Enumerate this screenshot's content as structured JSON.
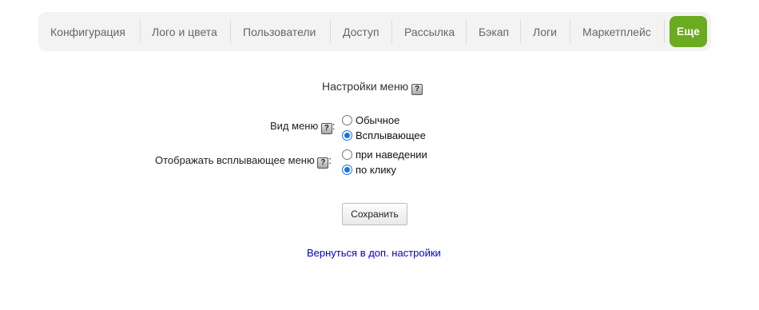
{
  "nav": {
    "items": [
      {
        "label": "Конфигурация"
      },
      {
        "label": "Лого и цвета"
      },
      {
        "label": "Пользователи"
      },
      {
        "label": "Доступ"
      },
      {
        "label": "Рассылка"
      },
      {
        "label": "Бэкап"
      },
      {
        "label": "Логи"
      },
      {
        "label": "Маркетплейс"
      }
    ],
    "more_label": "Еще",
    "accent_color": "#6aab1f"
  },
  "section": {
    "title": "Настройки меню",
    "help_glyph": "?"
  },
  "menu_type": {
    "label": "Вид меню",
    "suffix": ":",
    "options": [
      "Обычное",
      "Всплывающее"
    ],
    "selected": "Всплывающее"
  },
  "popup_display": {
    "label": "Отображать всплывающее меню",
    "suffix": ":",
    "options": [
      "при наведении",
      "по клику"
    ],
    "selected": "по клику"
  },
  "save_label": "Сохранить",
  "back_link": "Вернуться в доп. настройки"
}
